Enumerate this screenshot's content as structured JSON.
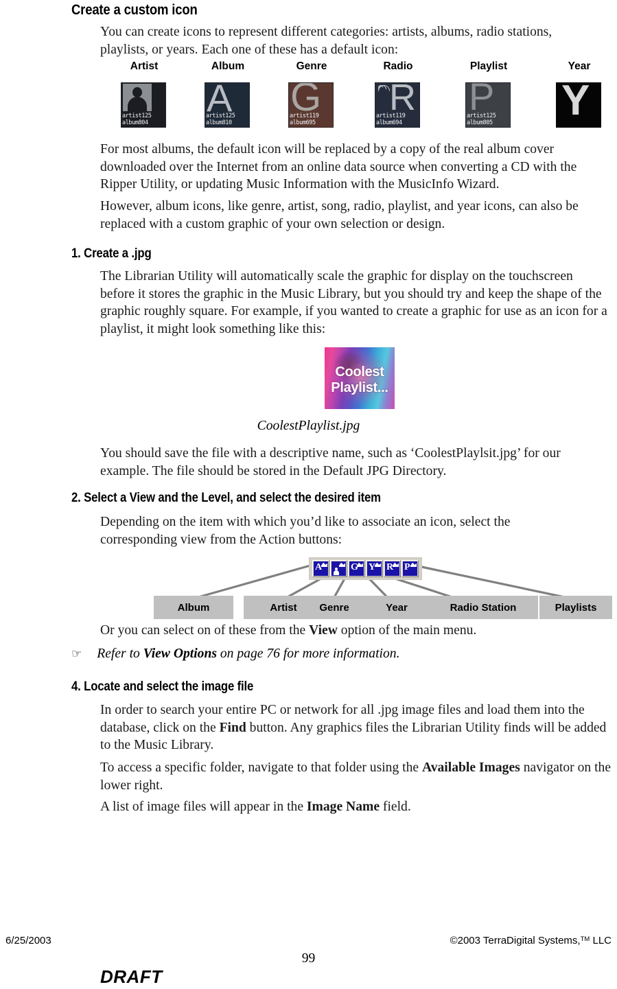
{
  "document": {
    "heading": "Create a custom icon",
    "intro": "You can create icons to represent different categories: artists, albums, radio stations, playlists, or years.  Each one of these has a default icon:",
    "para_albums": "For most albums, the default icon will be replaced by a copy of the real album cover downloaded over the Internet from an online data source when converting a CD with the Ripper Utility, or updating Music Information with the MusicInfo Wizard.",
    "para_however": "However, album icons, like genre, artist, song, radio, playlist, and year icons, can also be replaced with a custom graphic of your own selection or design."
  },
  "default_icons": {
    "items": [
      {
        "label": "Artist",
        "glyph": "",
        "line1": "artist125",
        "line2": "album804",
        "bg": "#1b1d22",
        "frame": "solid"
      },
      {
        "label": "Album",
        "glyph": "A",
        "line1": "artist125",
        "line2": "album810",
        "bg": "#1f2a38",
        "frame": "solid"
      },
      {
        "label": "Genre",
        "glyph": "G",
        "line1": "artist119",
        "line2": "album695",
        "bg": "#5a3830",
        "frame": "dotted"
      },
      {
        "label": "Radio",
        "glyph": "R",
        "line1": "artist119",
        "line2": "album694",
        "bg": "#252d3d",
        "frame": "dotted"
      },
      {
        "label": "Playlist",
        "glyph": "P",
        "line1": "artist125",
        "line2": "album805",
        "bg": "#3d4146",
        "frame": "dotted"
      },
      {
        "label": "Year",
        "glyph": "Y",
        "line1": "",
        "line2": "",
        "bg": "#050505",
        "frame": "none"
      }
    ]
  },
  "section1": {
    "heading": "1.  Create a .jpg",
    "para1": "The Librarian Utility will automatically scale the graphic for display on the touchscreen before it stores the graphic in the Music Library, but you should try and keep the shape of the graphic roughly square.  For example, if you wanted to create a graphic for use as an icon for a playlist, it might look something like this:",
    "sample_image": {
      "line1": "Coolest",
      "line2": "Playlist..."
    },
    "caption": "CoolestPlaylist.jpg",
    "para2": "You should save the file with a descriptive name, such as ‘CoolestPlaylsit.jpg’ for our example.  The file should be stored in the Default JPG Directory."
  },
  "section2": {
    "heading": "2.  Select a View and the Level, and select the desired item",
    "para1": "Depending on the item with which you’d like to associate an icon, select the corresponding view from the Action buttons:",
    "toolbar_buttons": [
      {
        "glyph": "A",
        "name": "album"
      },
      {
        "glyph": "",
        "name": "artist"
      },
      {
        "glyph": "G",
        "name": "genre"
      },
      {
        "glyph": "Y",
        "name": "year"
      },
      {
        "glyph": "R",
        "name": "radio-station"
      },
      {
        "glyph": "P",
        "name": "playlists"
      }
    ],
    "callouts": [
      {
        "label": "Album"
      },
      {
        "label": "Artist"
      },
      {
        "label": "Genre"
      },
      {
        "label": "Year"
      },
      {
        "label": "Radio Station"
      },
      {
        "label": "Playlists"
      }
    ],
    "para_menu_pre": "Or you can select on of these from the ",
    "para_menu_bold": "View",
    "para_menu_post": " option of the main menu.",
    "note_hand": "☞",
    "note_pre": "Refer to ",
    "note_bold": "View Options",
    "note_post": " on page 76 for more information."
  },
  "section4": {
    "heading": "4.  Locate and select the image file",
    "para1_pre": "In order to search your entire PC or network for all .jpg image files and load them into the database, click on the ",
    "para1_bold": "Find",
    "para1_post": " button.  Any graphics files the Librarian Utility finds will be added to the Music Library.",
    "para2_pre": "To access a specific folder, navigate to that folder using the ",
    "para2_bold": "Available Images",
    "para2_post": " navigator on the lower right.",
    "para3_pre": "A list of image files will appear in the ",
    "para3_bold": "Image Name",
    "para3_post": " field."
  },
  "footer": {
    "date": "6/25/2003",
    "copyright_pre": "©2003 TerraDigital Systems,",
    "copyright_tm": "TM",
    "copyright_post": " LLC",
    "page_number": "99",
    "draft": "DRAFT"
  }
}
